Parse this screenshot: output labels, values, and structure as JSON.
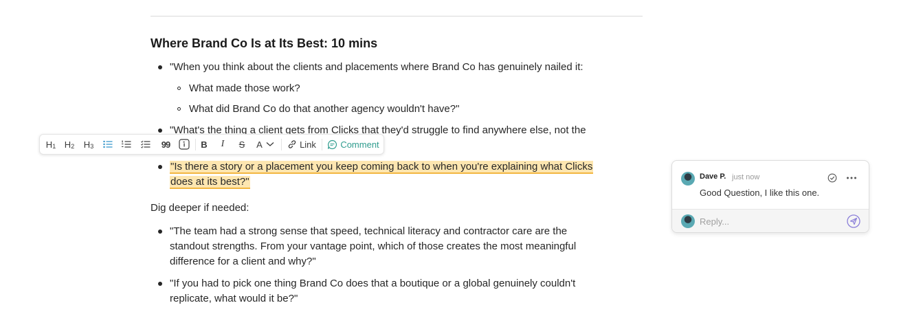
{
  "document": {
    "heading": "Where Brand Co Is at Its Best: 10 mins",
    "q1_line1": "\"When you think about the clients and placements where Brand Co has genuinely nailed it:",
    "q1_sub1": "What made those work?",
    "q1_sub2": "What did Brand Co do that another agency wouldn't have?\"",
    "q2_line1": "\"What's the thing a client gets from Clicks that they'd struggle to find anywhere else, not the",
    "q3_line1": "\"Is there a story or a placement you keep coming back to when you're explaining what Clicks",
    "q3_line2": "does at its best?\"",
    "deeper_label": "Dig deeper if needed:",
    "d1_line1": "\"The team had a strong sense that speed, technical literacy and contractor care are the",
    "d1_line2": "standout strengths. From your vantage point, which of those creates the most meaningful",
    "d1_line3": "difference for a client and why?\"",
    "d2_line1": "\"If you had to pick one thing Brand Co does that a boutique or a global genuinely couldn't",
    "d2_line2": "replicate, what would it be?\""
  },
  "toolbar": {
    "h1": "H",
    "h1_sub": "1",
    "h2": "H",
    "h2_sub": "2",
    "h3": "H",
    "h3_sub": "3",
    "quote": "99",
    "bold": "B",
    "italic": "I",
    "strike": "S",
    "text_color": "A",
    "link": "Link",
    "comment": "Comment",
    "icons": [
      "bullet-list-icon",
      "numbered-list-icon",
      "checklist-icon",
      "quote-icon",
      "inline-code-icon",
      "chevron-down-icon",
      "link-icon",
      "comment-icon"
    ],
    "active_color": "#2a8fc7",
    "comment_color": "#2f9c8e"
  },
  "comment_panel": {
    "author": "Dave P.",
    "time": "just now",
    "text": "Good Question, I like this one.",
    "reply_placeholder": "Reply...",
    "icons": [
      "resolve-check-icon",
      "more-options-icon",
      "send-icon"
    ]
  },
  "colors": {
    "highlight": "#fde6b0",
    "highlight_underline": "#f2b640",
    "send_icon": "#8b7fd9"
  }
}
